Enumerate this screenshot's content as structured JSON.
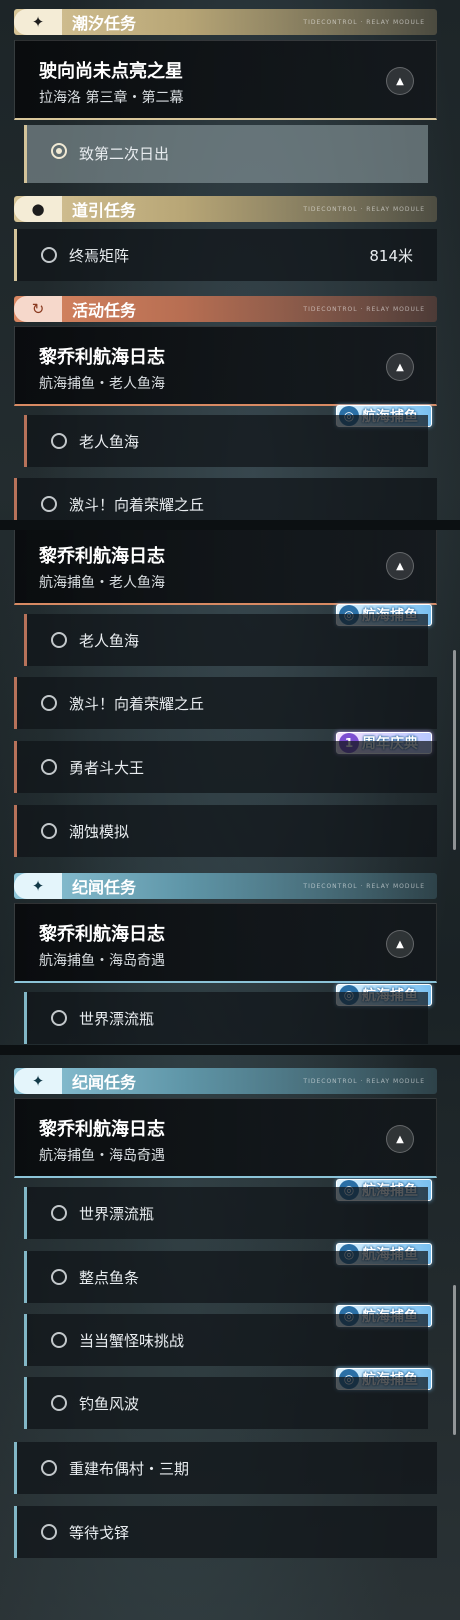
{
  "tasks": {
    "tide": {
      "header": "潮汐任务",
      "header_icon": "✦",
      "title": "驶向尚未点亮之星",
      "subtitle": "拉海洛 第三章・第二幕",
      "item": "致第二次日出"
    },
    "guide": {
      "header": "道引任务",
      "header_icon": "●",
      "item": "终焉矩阵",
      "distance": "814米"
    },
    "event": {
      "header": "活动任务",
      "header_icon": "↻",
      "title": "黎乔利航海日志",
      "subtitle": "航海捕鱼・老人鱼海",
      "items": [
        "老人鱼海",
        "激斗！向着荣耀之丘",
        "勇者斗大王",
        "潮蚀模拟"
      ],
      "partial": "激斗！向着荣耀之丘"
    },
    "chronicle": {
      "header": "纪闻任务",
      "header_icon": "✦",
      "title": "黎乔利航海日志",
      "subtitle": "航海捕鱼・海岛奇遇",
      "items": [
        "世界漂流瓶",
        "整点鱼条",
        "当当蟹怪味挑战",
        "钓鱼风波",
        "重建布偶村・三期",
        "等待戈铎"
      ]
    }
  },
  "badges": {
    "fishing": "航海捕鱼",
    "anniversary": "周年庆典",
    "fishing_icon": "fish-icon",
    "anniversary_icon": "1st-icon"
  },
  "header_deco": "TIDECONTROL · RELAY MODULE",
  "collapse_icon": "▲",
  "colors": {
    "gold": "#d6c497",
    "orange": "#d98762",
    "blue": "#8fc6d9"
  }
}
